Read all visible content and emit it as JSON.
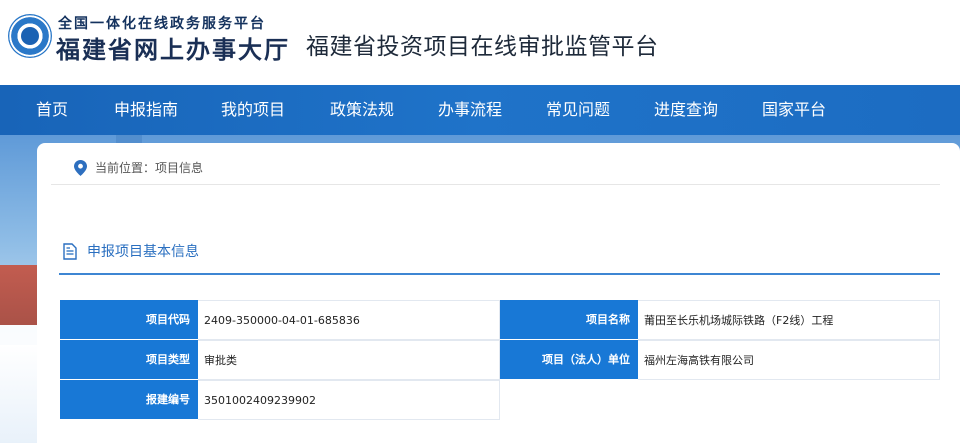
{
  "header": {
    "logo_top": "全国一体化在线政务服务平台",
    "logo_bottom": "福建省网上办事大厅",
    "site_title": "福建省投资项目在线审批监管平台"
  },
  "nav": {
    "items": [
      "首页",
      "申报指南",
      "我的项目",
      "政策法规",
      "办事流程",
      "常见问题",
      "进度查询",
      "国家平台"
    ]
  },
  "breadcrumb": {
    "icon": "location-pin-icon",
    "text": "当前位置：项目信息"
  },
  "section": {
    "icon": "document-icon",
    "title": "申报项目基本信息"
  },
  "info": {
    "rows": [
      {
        "label1": "项目代码",
        "value1": "2409-350000-04-01-685836",
        "label2": "项目名称",
        "value2": "莆田至长乐机场城际铁路（F2线）工程"
      },
      {
        "label1": "项目类型",
        "value1": "审批类",
        "label2": "项目（法人）单位",
        "value2": "福州左海高铁有限公司"
      },
      {
        "label1": "报建编号",
        "value1": "3501002409239902"
      }
    ]
  },
  "colors": {
    "nav_bg": "#1864b8",
    "label_bg": "#1878d6",
    "accent": "#2a6fc0"
  }
}
